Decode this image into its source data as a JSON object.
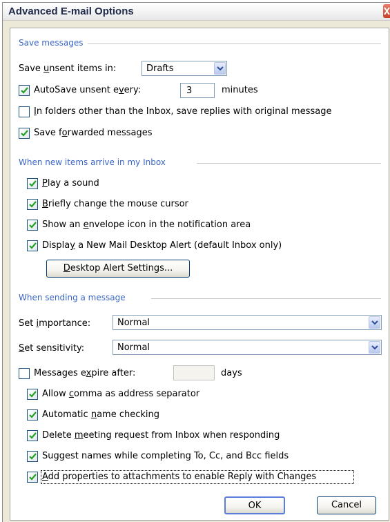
{
  "window": {
    "title": "Advanced E-mail Options"
  },
  "save_messages": {
    "section_title": "Save messages",
    "save_unsent_label_pre": "Save ",
    "save_unsent_label_u": "u",
    "save_unsent_label_post": "nsent items in:",
    "save_unsent_value": "Drafts",
    "autosave": {
      "checked": true,
      "label_pre": "AutoSave unsent e",
      "label_u": "v",
      "label_post": "ery:",
      "value": "3",
      "unit": "minutes"
    },
    "save_replies": {
      "checked": false,
      "label_u": "I",
      "label_post": "n folders other than the Inbox, save replies with original message"
    },
    "save_forwarded": {
      "checked": true,
      "label_pre": "Save f",
      "label_u": "o",
      "label_post": "rwarded messages"
    }
  },
  "new_items": {
    "section_title": "When new items arrive in my Inbox",
    "play_sound": {
      "checked": true,
      "label_u": "P",
      "label_post": "lay a sound"
    },
    "change_cursor": {
      "checked": true,
      "label_u": "B",
      "label_post": "riefly change the mouse cursor"
    },
    "envelope_icon": {
      "checked": true,
      "label_pre": "Show an ",
      "label_u": "e",
      "label_post": "nvelope icon in the notification area"
    },
    "desktop_alert": {
      "checked": true,
      "label_pre": "Displa",
      "label_u": "y",
      "label_post": " a New Mail Desktop Alert (default Inbox only)"
    },
    "alert_settings_button_u": "D",
    "alert_settings_button_post": "esktop Alert Settings..."
  },
  "sending": {
    "section_title": "When sending a message",
    "importance_label_pre": "Set ",
    "importance_label_u": "i",
    "importance_label_post": "mportance:",
    "importance_value": "Normal",
    "sensitivity_label_u": "S",
    "sensitivity_label_post": "et sensitivity:",
    "sensitivity_value": "Normal",
    "expire": {
      "checked": false,
      "label_pre": "Messages e",
      "label_u": "x",
      "label_post": "pire after:",
      "value": "",
      "unit": "days"
    },
    "comma_separator": {
      "checked": true,
      "label_pre": "Allow ",
      "label_u": "c",
      "label_post": "omma as address separator"
    },
    "name_checking": {
      "checked": true,
      "label_pre": "Automatic ",
      "label_u": "n",
      "label_post": "ame checking"
    },
    "delete_meeting": {
      "checked": true,
      "label_pre": "Delete ",
      "label_u": "m",
      "label_post": "eeting request from Inbox when responding"
    },
    "suggest_names": {
      "checked": true,
      "label": "Suggest names while completing To, Cc, and Bcc fields"
    },
    "add_properties": {
      "checked": true,
      "label_u": "A",
      "label_post": "dd properties to attachments to enable Reply with Changes"
    }
  },
  "buttons": {
    "ok": "OK",
    "cancel": "Cancel"
  }
}
